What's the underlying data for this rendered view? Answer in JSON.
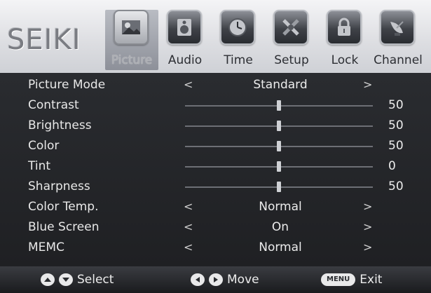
{
  "brand": "SEIKI",
  "tabs": [
    {
      "label": "Picture",
      "icon": "picture-icon",
      "active": true
    },
    {
      "label": "Audio",
      "icon": "speaker-icon",
      "active": false
    },
    {
      "label": "Time",
      "icon": "clock-icon",
      "active": false
    },
    {
      "label": "Setup",
      "icon": "tools-icon",
      "active": false
    },
    {
      "label": "Lock",
      "icon": "padlock-icon",
      "active": false
    },
    {
      "label": "Channel",
      "icon": "satellite-dish-icon",
      "active": false
    }
  ],
  "menu": {
    "picture_mode": {
      "label": "Picture Mode",
      "value": "Standard",
      "left": "<",
      "right": ">"
    },
    "contrast": {
      "label": "Contrast",
      "value": "50",
      "level": 50
    },
    "brightness": {
      "label": "Brightness",
      "value": "50",
      "level": 50
    },
    "color": {
      "label": "Color",
      "value": "50",
      "level": 50
    },
    "tint": {
      "label": "Tint",
      "value": "0",
      "level": 0
    },
    "sharpness": {
      "label": "Sharpness",
      "value": "50",
      "level": 50
    },
    "color_temp": {
      "label": "Color Temp.",
      "value": "Normal",
      "left": "<",
      "right": ">"
    },
    "blue_screen": {
      "label": "Blue Screen",
      "value": "On",
      "left": "<",
      "right": ">"
    },
    "memc": {
      "label": "MEMC",
      "value": "Normal",
      "left": "<",
      "right": ">"
    }
  },
  "footer": {
    "select": "Select",
    "move": "Move",
    "menu_key": "MENU",
    "exit": "Exit"
  },
  "colors": {
    "menu_bg": "#222327",
    "header_bg": "#dcdde1",
    "text": "#ececec"
  }
}
